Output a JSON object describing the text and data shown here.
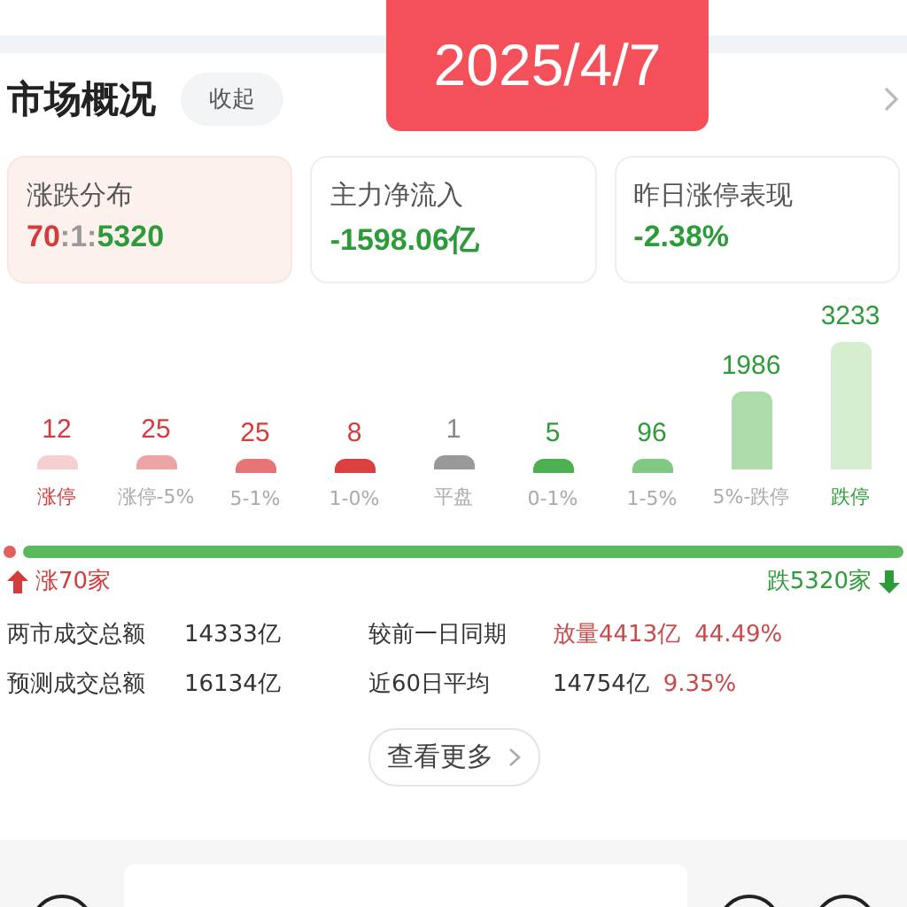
{
  "date_badge": "2025/4/7",
  "header": {
    "title": "市场概况",
    "collapse_button": "收起"
  },
  "cards": [
    {
      "title": "涨跌分布",
      "selected": true,
      "value_parts": [
        {
          "text": "70",
          "color": "#d43c3c"
        },
        {
          "text": ":1:",
          "color": "#999999"
        },
        {
          "text": "5320",
          "color": "#2e9b3a"
        }
      ]
    },
    {
      "title": "主力净流入",
      "selected": false,
      "value_parts": [
        {
          "text": "-1598.06亿",
          "color": "#2e9b3a"
        }
      ]
    },
    {
      "title": "昨日涨停表现",
      "selected": false,
      "value_parts": [
        {
          "text": "-2.38%",
          "color": "#2e9b3a"
        }
      ]
    }
  ],
  "buckets": [
    {
      "count": "12",
      "label": "涨停",
      "kind": "rise",
      "emphasized": true,
      "color": "#f6d0d0"
    },
    {
      "count": "25",
      "label": "涨停-5%",
      "kind": "rise",
      "emphasized": false,
      "color": "#eda4a4"
    },
    {
      "count": "25",
      "label": "5-1%",
      "kind": "rise",
      "emphasized": false,
      "color": "#e77575"
    },
    {
      "count": "8",
      "label": "1-0%",
      "kind": "rise",
      "emphasized": false,
      "color": "#da4040"
    },
    {
      "count": "1",
      "label": "平盘",
      "kind": "flat",
      "emphasized": false,
      "color": "#999999"
    },
    {
      "count": "5",
      "label": "0-1%",
      "kind": "fall",
      "emphasized": false,
      "color": "#4caf50"
    },
    {
      "count": "96",
      "label": "1-5%",
      "kind": "fall",
      "emphasized": false,
      "color": "#80c884"
    },
    {
      "count": "1986",
      "label": "5%-跌停",
      "kind": "fall",
      "emphasized": false,
      "color": "#aedca8"
    },
    {
      "count": "3233",
      "label": "跌停",
      "kind": "fall",
      "emphasized": true,
      "color": "#d5eecf"
    }
  ],
  "ratio": {
    "level": 0.013,
    "up_label": "涨70家",
    "down_label": "跌5320家"
  },
  "stats": [
    {
      "label": "两市成交总额",
      "value": "14333亿",
      "compare_label": "较前一日同期",
      "compare_parts": [
        {
          "text": "放量4413亿",
          "color": "#c94a4a"
        },
        {
          "text": "44.49%",
          "color": "#c94a4a"
        }
      ]
    },
    {
      "label": "预测成交总额",
      "value": "16134亿",
      "compare_label": "近60日平均",
      "compare_parts": [
        {
          "text": "14754亿",
          "color": "#333333"
        },
        {
          "text": "9.35%",
          "color": "#c94a4a"
        }
      ]
    }
  ],
  "more_button": "查看更多"
}
